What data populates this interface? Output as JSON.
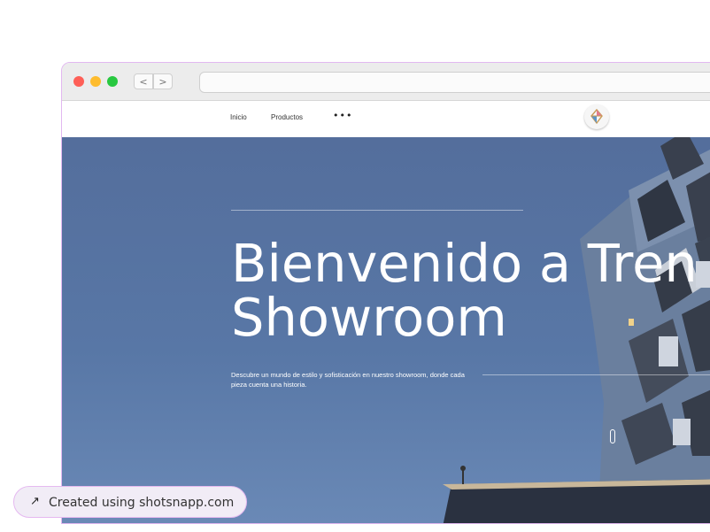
{
  "browser": {
    "back_icon": "chevron-left-icon",
    "forward_icon": "chevron-right-icon",
    "back_glyph": "<",
    "forward_glyph": ">",
    "url": ""
  },
  "site_nav": {
    "items": [
      {
        "label": "Inicio"
      },
      {
        "label": "Productos"
      }
    ],
    "more_label": "•••",
    "logo_icon": "diamond-logo-icon"
  },
  "hero": {
    "title_line1": "Bienvenido a Tren",
    "title_line2": "Showroom",
    "description": "Descubre un mundo de estilo y sofisticación en nuestro showroom, donde cada pieza cuenta una historia.",
    "scroll_icon": "scroll-indicator-icon"
  },
  "badge": {
    "icon": "arrow-up-right-icon",
    "icon_glyph": "↗",
    "text": "Created using shotsnapp.com"
  },
  "colors": {
    "hero_bg": "#5877a6",
    "window_border": "#e2b8f0",
    "badge_bg": "#f1ecf6"
  }
}
